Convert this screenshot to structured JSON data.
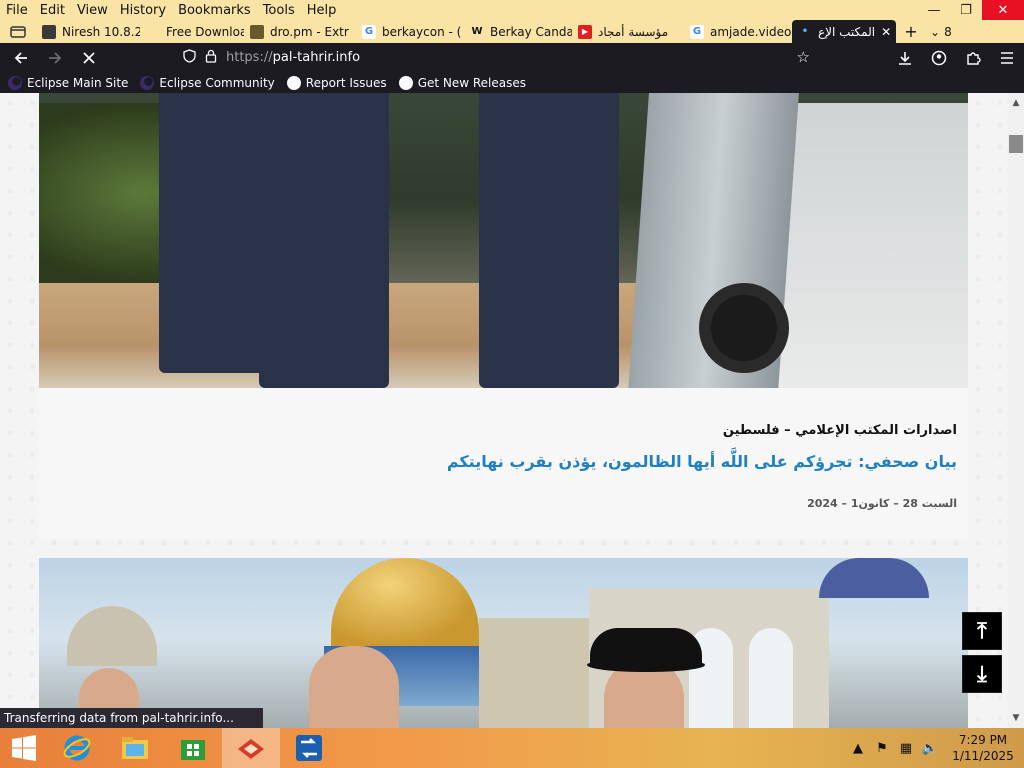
{
  "menu": {
    "items": [
      "File",
      "Edit",
      "View",
      "History",
      "Bookmarks",
      "Tools",
      "Help"
    ]
  },
  "window_controls": {
    "minimize": "—",
    "restore": "❐",
    "close": "✕"
  },
  "tabs": [
    {
      "label": "Niresh 10.8.2",
      "icon_color": "#3a3a3a",
      "icon_text": ""
    },
    {
      "label": "Free Downloa",
      "icon_color": "#f9e4a6",
      "icon_text": ""
    },
    {
      "label": "dro.pm - Extr",
      "icon_color": "#6a5a2a",
      "icon_text": ""
    },
    {
      "label": "berkaycon - (",
      "icon_color": "#ffffff",
      "icon_text": "G"
    },
    {
      "label": "Berkay Canda",
      "icon_color": "#f9e4a6",
      "icon_text": "W"
    },
    {
      "label": "مؤسسة أمجاد",
      "icon_color": "#e02020",
      "icon_text": "▶"
    },
    {
      "label": "amjade.video",
      "icon_color": "#ffffff",
      "icon_text": "G"
    }
  ],
  "active_tab": {
    "label": "المكتب الإع",
    "close": "✕"
  },
  "tab_overflow_count": "8",
  "nav": {
    "back": "back",
    "forward": "forward",
    "stop": "stop",
    "url_scheme": "https://",
    "url_host": "pal-tahrir.info"
  },
  "bookmarks": [
    {
      "label": "Eclipse Main Site"
    },
    {
      "label": "Eclipse Community"
    },
    {
      "label": "Report Issues"
    },
    {
      "label": "Get New Releases"
    }
  ],
  "article": {
    "category": "اصدارات المكتب الإعلامي – فلسطين",
    "headline": "بيان صحفي: تجرؤكم على اللَّه أيها الظالمون، يؤذن بقرب نهايتكم",
    "date": "السبت 28 – كانون1 – 2024"
  },
  "float_buttons": {
    "up": "⤒",
    "down": "⤓"
  },
  "status": {
    "text": "Transferring data from pal-tahrir.info..."
  },
  "taskbar": {
    "clock_time": "7:29 PM",
    "clock_date": "1/11/2025"
  },
  "colors": {
    "headline": "#1f80c4",
    "chrome_dark": "#1c1b22",
    "chrome_light": "#f9e4a6",
    "close_red": "#e81123"
  }
}
